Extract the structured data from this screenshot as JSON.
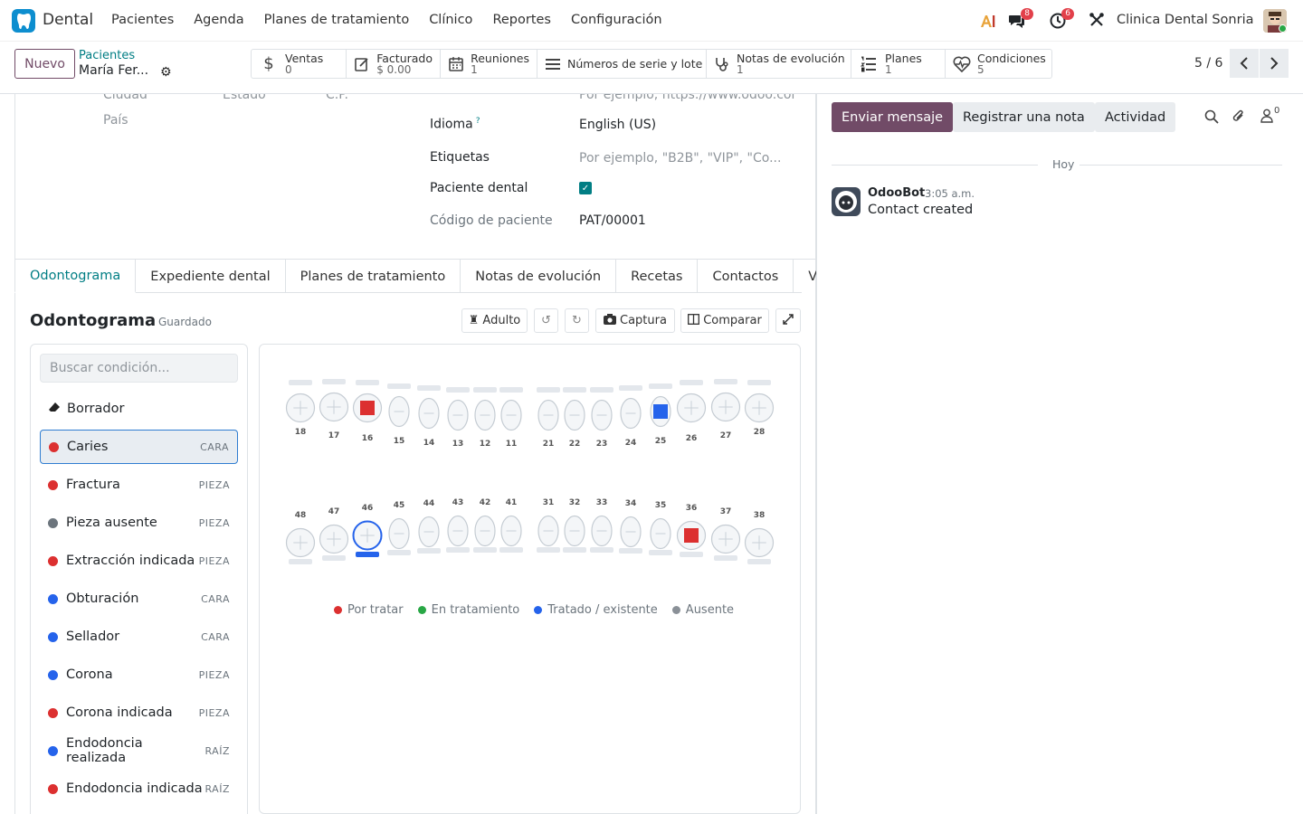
{
  "app": {
    "name": "Dental"
  },
  "menu": [
    "Pacientes",
    "Agenda",
    "Planes de tratamiento",
    "Clínico",
    "Reportes",
    "Configuración"
  ],
  "systray": {
    "messages_count": "8",
    "activities_count": "6",
    "company": "Clinica Dental Sonria"
  },
  "control": {
    "new_label": "Nuevo",
    "breadcrumb_parent": "Pacientes",
    "breadcrumb_current": "María Fer...",
    "pager": "5 / 6"
  },
  "smart_buttons": [
    {
      "icon": "dollar-icon",
      "label": "Ventas",
      "value": "0"
    },
    {
      "icon": "invoice-icon",
      "label": "Facturado",
      "value": "$ 0.00"
    },
    {
      "icon": "calendar-icon",
      "label": "Reuniones",
      "value": "1"
    },
    {
      "icon": "list-icon",
      "label": "Números de serie y lote",
      "value": ""
    },
    {
      "icon": "stethoscope-icon",
      "label": "Notas de evolución",
      "value": "1"
    },
    {
      "icon": "list-numbered-icon",
      "label": "Planes",
      "value": "1"
    },
    {
      "icon": "heart-pulse-icon",
      "label": "Condiciones",
      "value": "5"
    }
  ],
  "form": {
    "city_label": "Ciudad",
    "state_label": "Estado",
    "zip_label": "C.P.",
    "website_placeholder": "Por ejemplo, https://www.odoo.com",
    "country_label": "País",
    "language_label": "Idioma",
    "language_help": "?",
    "language_value": "English (US)",
    "tags_label": "Etiquetas",
    "tags_placeholder": "Por ejemplo, \"B2B\", \"VIP\", \"Co...",
    "dental_patient_label": "Paciente dental",
    "patient_code_label": "Código de paciente",
    "patient_code_value": "PAT/00001"
  },
  "tabs": [
    "Odontograma",
    "Expediente dental",
    "Planes de tratamiento",
    "Notas de evolución",
    "Recetas",
    "Contactos",
    "Ve"
  ],
  "odontogram": {
    "title": "Odontograma",
    "status": "Guardado",
    "adult_label": "Adulto",
    "capture_label": "Captura",
    "compare_label": "Comparar",
    "search_placeholder": "Buscar condición...",
    "eraser_label": "Borrador",
    "conditions": [
      {
        "name": "Caries",
        "scope": "CARA",
        "color": "#dc3030",
        "selected": true
      },
      {
        "name": "Fractura",
        "scope": "PIEZA",
        "color": "#dc3030"
      },
      {
        "name": "Pieza ausente",
        "scope": "PIEZA",
        "color": "#6c757d"
      },
      {
        "name": "Extracción indicada",
        "scope": "PIEZA",
        "color": "#dc3030"
      },
      {
        "name": "Obturación",
        "scope": "CARA",
        "color": "#2563eb"
      },
      {
        "name": "Sellador",
        "scope": "CARA",
        "color": "#2563eb"
      },
      {
        "name": "Corona",
        "scope": "PIEZA",
        "color": "#2563eb"
      },
      {
        "name": "Corona indicada",
        "scope": "PIEZA",
        "color": "#dc3030"
      },
      {
        "name": "Endodoncia realizada",
        "scope": "RAÍZ",
        "color": "#2563eb"
      },
      {
        "name": "Endodoncia indicada",
        "scope": "RAÍZ",
        "color": "#dc3030"
      }
    ],
    "upper_teeth": [
      "18",
      "17",
      "16",
      "15",
      "14",
      "13",
      "12",
      "11",
      "21",
      "22",
      "23",
      "24",
      "25",
      "26",
      "27",
      "28"
    ],
    "lower_teeth": [
      "48",
      "47",
      "46",
      "45",
      "44",
      "43",
      "42",
      "41",
      "31",
      "32",
      "33",
      "34",
      "35",
      "36",
      "37",
      "38"
    ],
    "marks": {
      "16": "caries-red",
      "25": "filling-blue",
      "46": "crown-blue",
      "36": "caries-red"
    },
    "legend": [
      {
        "label": "Por tratar",
        "color": "#dc3030"
      },
      {
        "label": "En tratamiento",
        "color": "#28a745"
      },
      {
        "label": "Tratado / existente",
        "color": "#2563eb"
      },
      {
        "label": "Ausente",
        "color": "#8a9097"
      }
    ]
  },
  "chatter": {
    "send_message": "Enviar mensaje",
    "log_note": "Registrar una nota",
    "activity": "Actividad",
    "followers_count": "0",
    "date_separator": "Hoy",
    "messages": [
      {
        "author": "OdooBot",
        "time": "3:05 a.m.",
        "body": "Contact created"
      }
    ]
  }
}
